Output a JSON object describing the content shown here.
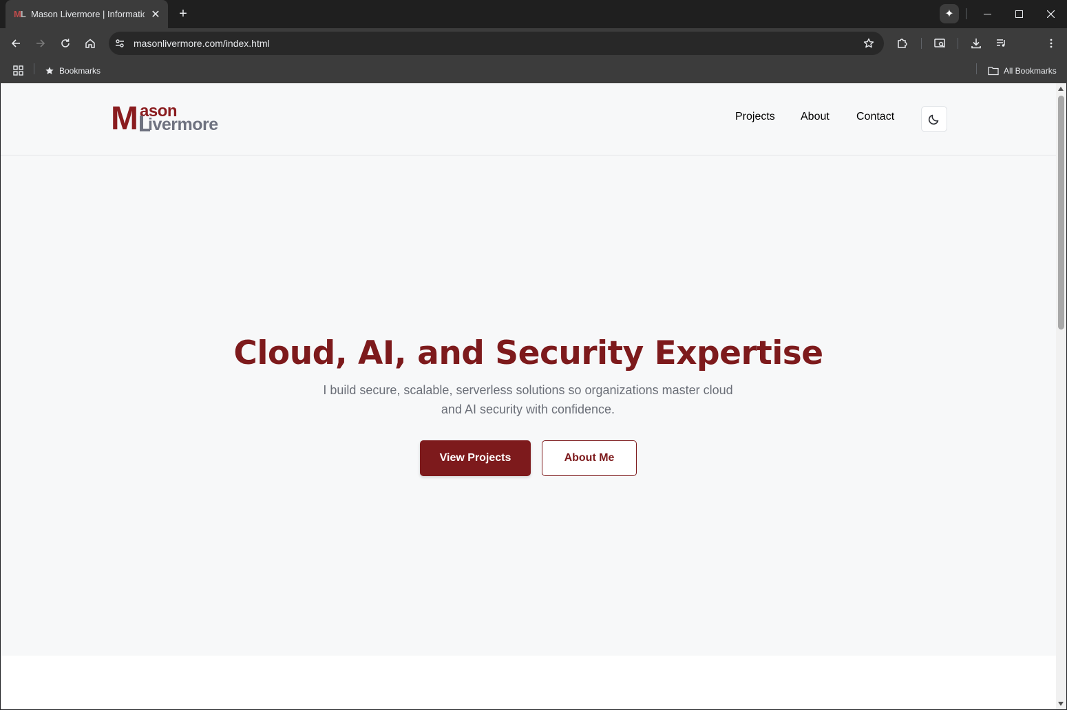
{
  "browser": {
    "tab": {
      "favicon_m": "M",
      "favicon_l": "L",
      "title": "Mason Livermore | Information",
      "close": "✕"
    },
    "new_tab": "+",
    "window_controls": {
      "minimize": "—",
      "maximize": "☐",
      "close": "✕"
    },
    "gemini": "✦",
    "url": "masonlivermore.com/index.html",
    "bookmarks_bar": {
      "bookmarks_label": "Bookmarks",
      "all_bookmarks_label": "All Bookmarks"
    },
    "icons": [
      "back-icon",
      "forward-icon",
      "reload-icon",
      "home-icon",
      "site-info-icon",
      "star-icon",
      "extensions-icon",
      "reading-mode-icon",
      "download-icon",
      "media-control-icon",
      "more-menu-icon",
      "apps-icon",
      "folder-icon"
    ]
  },
  "site": {
    "logo": {
      "m": "M",
      "ason": "ason",
      "ivermore": "ivermore"
    },
    "nav": [
      "Projects",
      "About",
      "Contact"
    ],
    "theme_toggle_icon": "moon-icon",
    "hero": {
      "title": "Cloud, AI, and Security Expertise",
      "subtitle": "I build secure, scalable, serverless solutions so organizations master cloud and AI security with confidence.",
      "primary_button": "View Projects",
      "secondary_button": "About Me"
    },
    "colors": {
      "brand": "#7d1a1c",
      "logo_gray": "#6e7280",
      "background": "#f7f8f9"
    }
  }
}
